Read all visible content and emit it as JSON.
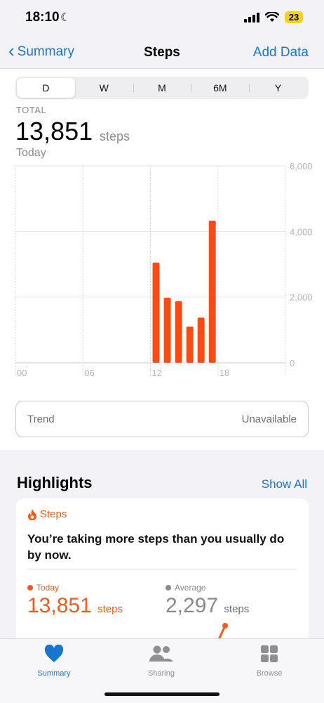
{
  "status": {
    "time": "18:10",
    "battery": "23"
  },
  "nav": {
    "back": "Summary",
    "title": "Steps",
    "action": "Add Data"
  },
  "segments": [
    "D",
    "W",
    "M",
    "6M",
    "Y"
  ],
  "selected_segment": "D",
  "summary": {
    "label": "TOTAL",
    "value": "13,851",
    "unit": "steps",
    "date": "Today"
  },
  "colors": {
    "accent": "#1677d2",
    "bars": "#fa4b12",
    "steps": "#f25b1e",
    "average": "#8a8a8e"
  },
  "chart_data": {
    "type": "bar",
    "x": [
      12,
      13,
      14,
      15,
      16,
      17
    ],
    "values": [
      3050,
      1980,
      1880,
      1100,
      1380,
      4330
    ],
    "xticks": [
      "00",
      "06",
      "12",
      "18"
    ],
    "yticks": [
      "6,000",
      "4,000",
      "2,000",
      "0"
    ],
    "xlim": [
      0,
      24
    ],
    "ylim": [
      0,
      6000
    ]
  },
  "trend": {
    "label": "Trend",
    "value": "Unavailable"
  },
  "highlights": {
    "title": "Highlights",
    "show_all": "Show All",
    "category": "Steps",
    "text": "You’re taking more steps than you usually do by now.",
    "today": {
      "label": "Today",
      "value": "13,851",
      "unit": "steps"
    },
    "average": {
      "label": "Average",
      "value": "2,297",
      "unit": "steps"
    }
  },
  "tabs": [
    {
      "label": "Summary",
      "icon": "heart-icon",
      "active": true
    },
    {
      "label": "Sharing",
      "icon": "people-icon",
      "active": false
    },
    {
      "label": "Browse",
      "icon": "grid-icon",
      "active": false
    }
  ]
}
